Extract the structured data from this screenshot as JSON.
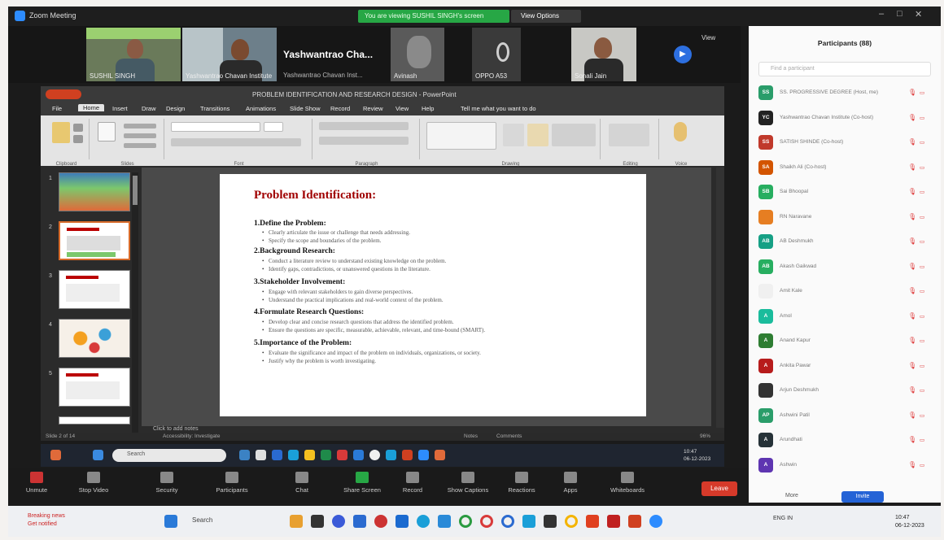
{
  "zoom": {
    "title": "Zoom Meeting",
    "share_banner": "You are viewing SUSHIL SINGH's screen",
    "view_options": "View Options",
    "view_label": "View"
  },
  "video_tiles": [
    {
      "name": "SUSHIL SINGH"
    },
    {
      "name": "Yashwantrao Chavan Institute"
    },
    {
      "name": "Yashwantrao Cha...",
      "sub": "Yashwantrao Chavan Inst..."
    },
    {
      "name": "Avinash"
    },
    {
      "name": "OPPO A53"
    },
    {
      "name": "Sonali Jain"
    }
  ],
  "powerpoint": {
    "title": "PROBLEM IDENTIFICATION AND RESEARCH DESIGN - PowerPoint",
    "tabs": [
      "File",
      "Home",
      "Insert",
      "Draw",
      "Design",
      "Transitions",
      "Animations",
      "Slide Show",
      "Record",
      "Review",
      "View",
      "Help",
      "Tell me what you want to do"
    ],
    "ribbon_groups": [
      "Clipboard",
      "Slides",
      "Font",
      "Paragraph",
      "Drawing",
      "Editing",
      "Voice"
    ],
    "notes_hint": "Click to add notes",
    "status_left": "Slide 2 of 14",
    "status_accessibility": "Accessibility: Investigate",
    "status_notes": "Notes",
    "status_comments": "Comments",
    "zoom_level": "96%"
  },
  "slide": {
    "title": "Problem Identification:",
    "sections": [
      {
        "heading": "1.Define the Problem:",
        "bullets": [
          "Clearly articulate the issue or challenge that needs addressing.",
          "Specify the scope and boundaries of the problem."
        ]
      },
      {
        "heading": "2.Background Research:",
        "bullets": [
          "Conduct a literature review to understand existing knowledge on the problem.",
          "Identify gaps, contradictions, or unanswered questions in the literature."
        ]
      },
      {
        "heading": "3.Stakeholder Involvement:",
        "bullets": [
          "Engage with relevant stakeholders to gain diverse perspectives.",
          "Understand the practical implications and real-world context of the problem."
        ]
      },
      {
        "heading": "4.Formulate Research Questions:",
        "bullets": [
          "Develop clear and concise research questions that address the identified problem.",
          "Ensure the questions are specific, measurable, achievable, relevant, and time-bound (SMART)."
        ]
      },
      {
        "heading": "5.Importance of the Problem:",
        "bullets": [
          "Evaluate the significance and impact of the problem on individuals, organizations, or society.",
          "Justify why the problem is worth investigating."
        ]
      }
    ]
  },
  "thumbnail_numbers": [
    "1",
    "2",
    "3",
    "4",
    "5"
  ],
  "inner_taskbar": {
    "search": "Search",
    "time": "10:47",
    "date": "06-12-2023"
  },
  "controls": [
    {
      "label": "Unmute",
      "icon": "mic-muted-icon"
    },
    {
      "label": "Stop Video",
      "icon": "video-icon"
    },
    {
      "label": "Security",
      "icon": "shield-icon"
    },
    {
      "label": "Participants",
      "count": "88",
      "icon": "participants-icon"
    },
    {
      "label": "Chat",
      "icon": "chat-icon"
    },
    {
      "label": "Share Screen",
      "icon": "share-screen-icon"
    },
    {
      "label": "Record",
      "icon": "record-icon"
    },
    {
      "label": "Show Captions",
      "icon": "captions-icon"
    },
    {
      "label": "Reactions",
      "icon": "reactions-icon"
    },
    {
      "label": "Apps",
      "icon": "apps-icon"
    },
    {
      "label": "Whiteboards",
      "icon": "whiteboard-icon"
    }
  ],
  "leave_label": "Leave",
  "participants_panel": {
    "title": "Participants (88)",
    "search_placeholder": "Find a participant",
    "rows": [
      {
        "initials": "SS",
        "name": "SS. PROGRESSIVE DEGREE (Host, me)",
        "color": "#2a9d6a"
      },
      {
        "initials": "YC",
        "name": "Yashwantrao Chavan Institute (Co-host)",
        "color": "#222222"
      },
      {
        "initials": "SS",
        "name": "SATISH SHINDE (Co-host)",
        "color": "#c0392b"
      },
      {
        "initials": "SA",
        "name": "Shaikh Ali (Co-host)",
        "color": "#d35400"
      },
      {
        "initials": "SB",
        "name": "Sai Bhoopal",
        "color": "#27ae60"
      },
      {
        "initials": "",
        "name": "RN Naravane",
        "color": "#e67e22"
      },
      {
        "initials": "AB",
        "name": "AB Deshmukh",
        "color": "#16a085"
      },
      {
        "initials": "AB",
        "name": "Akash Gaikwad",
        "color": "#27ae60"
      },
      {
        "initials": "",
        "name": "Amit Kale",
        "color": "#f0f0f0"
      },
      {
        "initials": "A",
        "name": "Amol",
        "color": "#1abc9c"
      },
      {
        "initials": "A",
        "name": "Anand Kapur",
        "color": "#2e7d32"
      },
      {
        "initials": "A",
        "name": "Ankita Pawar",
        "color": "#b71c1c"
      },
      {
        "initials": "",
        "name": "Arjun Deshmukh",
        "color": "#333333"
      },
      {
        "initials": "AP",
        "name": "Ashwini Patil",
        "color": "#2a9d6a"
      },
      {
        "initials": "A",
        "name": "Arundhati",
        "color": "#263238"
      },
      {
        "initials": "A",
        "name": "Ashwin",
        "color": "#5e35b1"
      }
    ],
    "mic_icon": "mic-muted-icon",
    "more_label": "More",
    "invite_label": "Invite"
  },
  "host_taskbar": {
    "notification_title": "Breaking news",
    "notification_sub": "Get notified",
    "search": "Search",
    "time": "10:47",
    "date": "06-12-2023",
    "lang": "ENG IN"
  }
}
